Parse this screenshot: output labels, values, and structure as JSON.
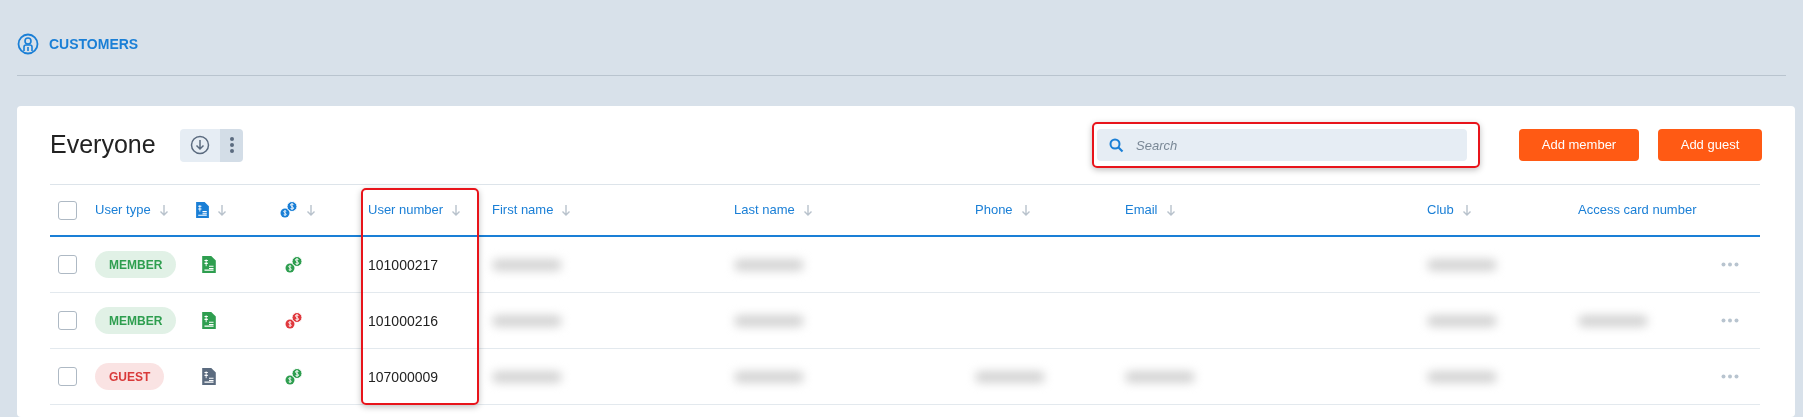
{
  "page": {
    "title": "CUSTOMERS"
  },
  "list": {
    "title": "Everyone"
  },
  "search": {
    "placeholder": "Search",
    "highlighted": true
  },
  "buttons": [
    "Add member",
    "Add guest"
  ],
  "columns": [
    {
      "kind": "checkbox",
      "checked": false
    },
    {
      "kind": "text",
      "label": "User type",
      "sortable": true,
      "highlighted": false
    },
    {
      "kind": "doc",
      "sortable": true
    },
    {
      "kind": "coins",
      "sortable": true
    },
    {
      "kind": "text",
      "label": "User number",
      "sortable": true,
      "highlighted": true
    },
    {
      "kind": "text",
      "label": "First name",
      "sortable": true,
      "highlighted": false
    },
    {
      "kind": "text",
      "label": "Last name",
      "sortable": true,
      "highlighted": false
    },
    {
      "kind": "text",
      "label": "Phone",
      "sortable": true,
      "highlighted": false
    },
    {
      "kind": "text",
      "label": "Email",
      "sortable": true,
      "highlighted": false
    },
    {
      "kind": "text",
      "label": "Club",
      "sortable": true,
      "highlighted": false
    },
    {
      "kind": "text",
      "label": "Access card number",
      "sortable": false,
      "highlighted": false
    }
  ],
  "rows": [
    {
      "checked": false,
      "user_type": "MEMBER",
      "color": "#2e9e4f",
      "doc": {
        "color": "#2e9e4f"
      },
      "coins": {
        "color": "#2e9e4f"
      },
      "user_number": "101000217",
      "cells": [
        {
          "kind": "blurred"
        },
        {
          "kind": "blurred"
        },
        {
          "kind": "empty"
        },
        {
          "kind": "empty"
        },
        {
          "kind": "blurred"
        },
        {
          "kind": "empty"
        }
      ]
    },
    {
      "checked": false,
      "user_type": "MEMBER",
      "color": "#2e9e4f",
      "doc": {
        "color": "#2e9e4f"
      },
      "coins": {
        "color": "#e0393e"
      },
      "user_number": "101000216",
      "cells": [
        {
          "kind": "blurred"
        },
        {
          "kind": "blurred"
        },
        {
          "kind": "empty"
        },
        {
          "kind": "empty"
        },
        {
          "kind": "blurred"
        },
        {
          "kind": "blurred"
        }
      ]
    },
    {
      "checked": false,
      "user_type": "GUEST",
      "color": "#d93a3a",
      "doc": {
        "color": "#5b6b7f"
      },
      "coins": {
        "color": "#2e9e4f"
      },
      "user_number": "107000009",
      "cells": [
        {
          "kind": "blurred"
        },
        {
          "kind": "blurred"
        },
        {
          "kind": "blurred"
        },
        {
          "kind": "blurred"
        },
        {
          "kind": "blurred"
        },
        {
          "kind": "empty"
        }
      ]
    }
  ]
}
